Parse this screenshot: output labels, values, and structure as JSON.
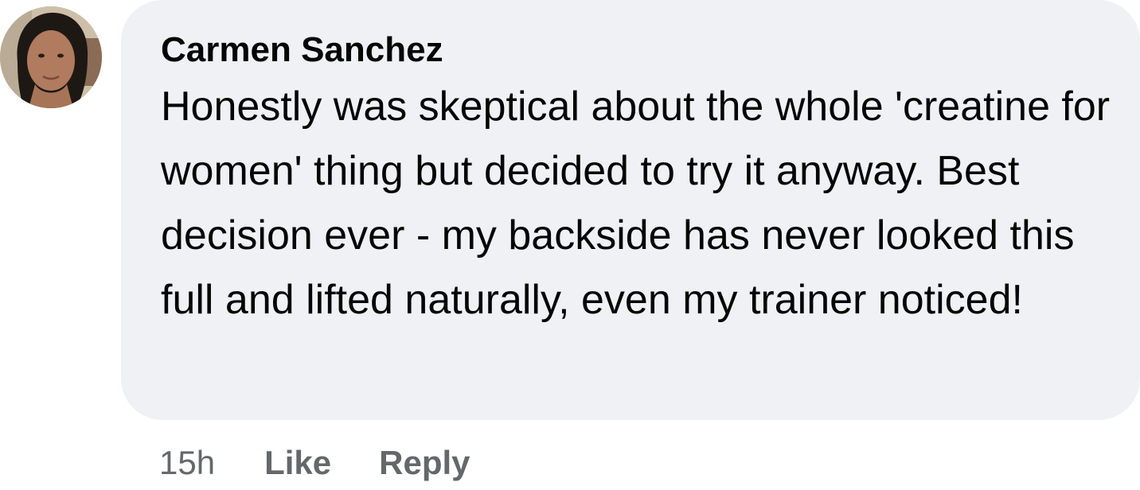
{
  "comment": {
    "author": "Carmen Sanchez",
    "text": "Honestly was skeptical about the whole 'creatine for women' thing but decided to try it anyway. Best decision ever - my backside has never looked this full and lifted naturally, even my trainer noticed!",
    "timestamp": "15h",
    "actions": {
      "like_label": "Like",
      "reply_label": "Reply"
    }
  },
  "colors": {
    "bubble_background": "#f0f1f5",
    "text": "#050505",
    "secondary_text": "#65676b"
  }
}
